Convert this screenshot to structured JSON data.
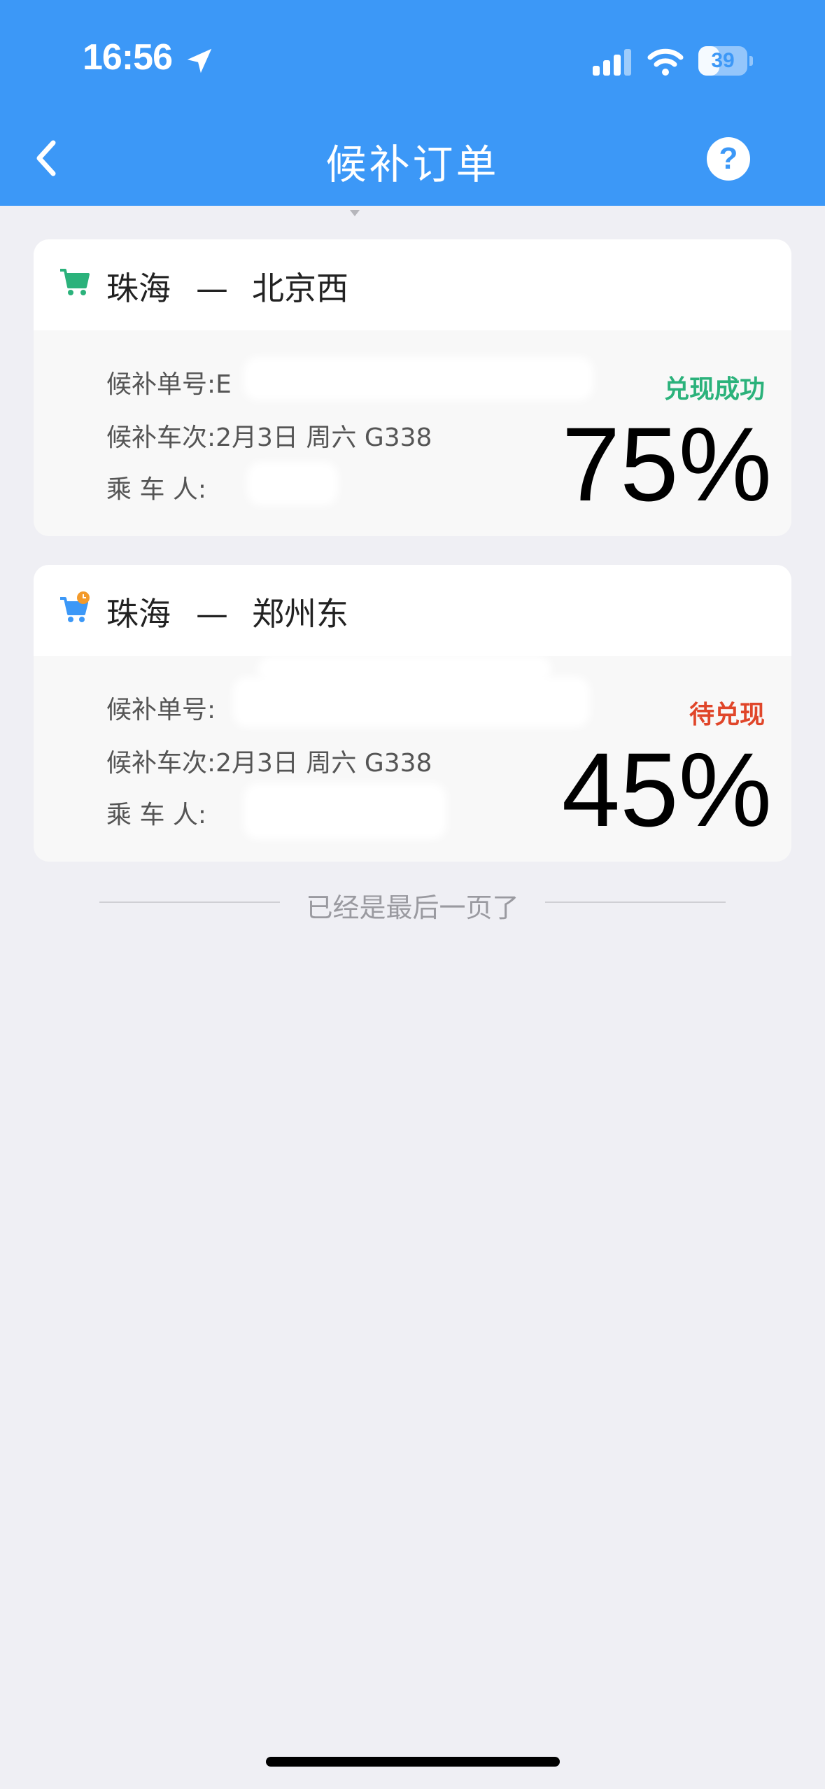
{
  "status_bar": {
    "time": "16:56",
    "battery": "39"
  },
  "nav": {
    "title": "候补订单",
    "help_label": "?"
  },
  "colors": {
    "header": "#3c98f7",
    "success": "#2bb27b",
    "pending": "#e0462a"
  },
  "orders": [
    {
      "route_from": "珠海",
      "route_sep": "—",
      "route_to": "北京西",
      "order_no_label": "候补单号:",
      "order_no": "E",
      "train_label": "候补车次:",
      "train": "2月3日 周六 G338",
      "passenger_label": "乘 车 人:",
      "status": "兑现成功",
      "percent": "75%",
      "icon": "cart-icon"
    },
    {
      "route_from": "珠海",
      "route_sep": "—",
      "route_to": "郑州东",
      "order_no_label": "候补单号:",
      "order_no": "",
      "train_label": "候补车次:",
      "train": "2月3日 周六 G338",
      "passenger_label": "乘 车 人:",
      "status": "待兑现",
      "percent": "45%",
      "icon": "cart-clock-icon"
    }
  ],
  "footer": {
    "end_text": "已经是最后一页了"
  }
}
